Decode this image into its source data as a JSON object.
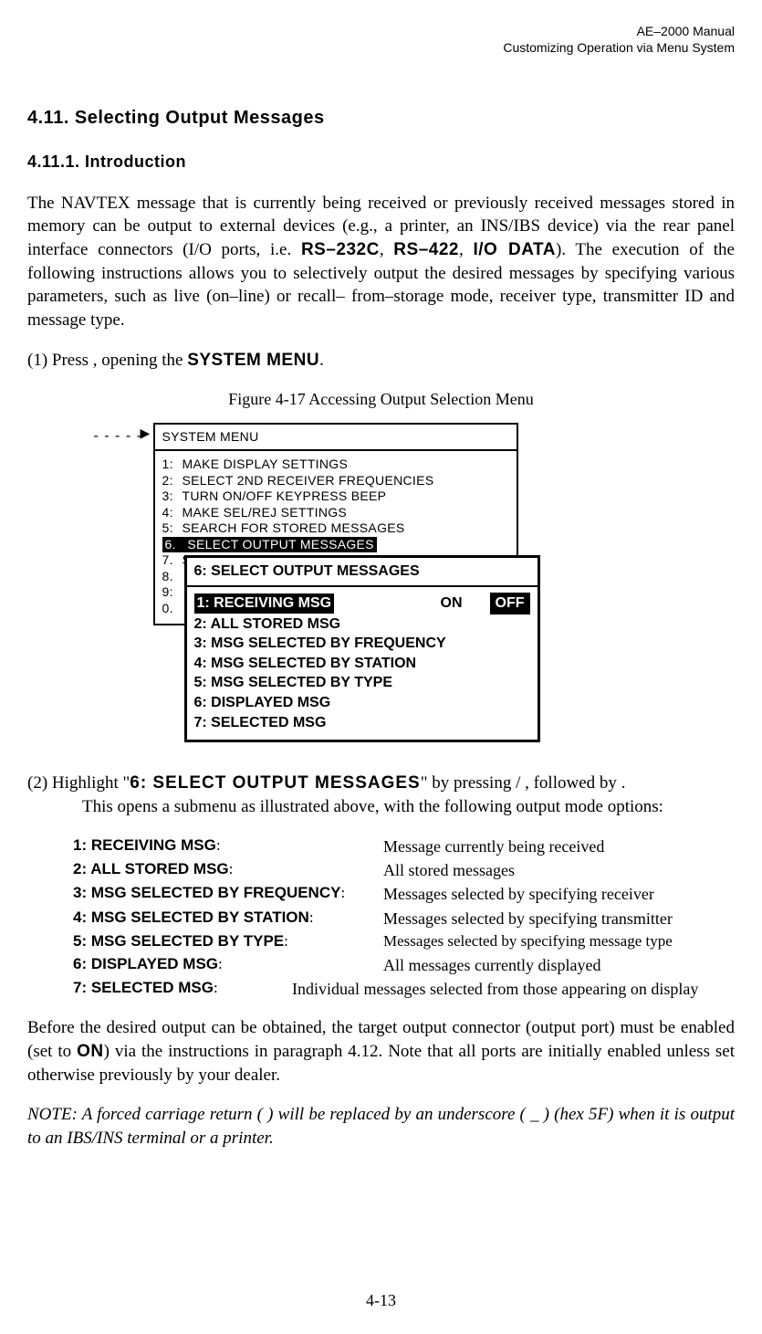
{
  "header": {
    "line1": "AE–2000 Manual",
    "line2": "Customizing Operation via Menu System"
  },
  "section_title": "4.11.  Selecting Output Messages",
  "subsection_title": "4.11.1.   Introduction",
  "intro_para": "The NAVTEX message that is currently being received or previously received messages stored in memory can be output to external devices (e.g., a printer, an INS/IBS device) via the rear panel interface connectors (I/O ports, i.e. ",
  "intro_rs232": "RS–232C",
  "intro_comma1": ", ",
  "intro_rs422": "RS–422",
  "intro_comma2": ", ",
  "intro_iodata": "I/O DATA",
  "intro_rest": "). The execution of the following instructions allows you to selectively output the desired messages by specifying various parameters, such as live (on–line) or recall– from–storage mode, receiver type, transmitter ID and message type.",
  "step1_pre": "(1)  Press       , opening the ",
  "step1_menu": "SYSTEM MENU",
  "step1_post": ".",
  "figure_caption": "Figure 4-17   Accessing Output Selection Menu",
  "menu": {
    "title": "SYSTEM MENU",
    "items": [
      {
        "num": "1:",
        "text": "MAKE DISPLAY SETTINGS"
      },
      {
        "num": "2:",
        "text": "SELECT 2ND RECEIVER FREQUENCIES"
      },
      {
        "num": "3:",
        "text": "TURN ON/OFF KEYPRESS BEEP"
      },
      {
        "num": "4:",
        "text": "MAKE SEL/REJ SETTINGS"
      },
      {
        "num": "5:",
        "text": "SEARCH FOR STORED MESSAGES"
      },
      {
        "num": "6.",
        "text": "SELECT OUTPUT MESSAGES",
        "hl": true
      },
      {
        "num": "7.",
        "text": "SET OUTPUT PORTS"
      },
      {
        "num": "8.",
        "text": ""
      },
      {
        "num": "9:",
        "text": ""
      },
      {
        "num": "0.",
        "text": ""
      }
    ]
  },
  "submenu": {
    "title": "6: SELECT OUTPUT MESSAGES",
    "row1_label": "1: RECEIVING MSG",
    "row1_on": "ON",
    "row1_off": "OFF",
    "items": [
      "2: ALL STORED MSG",
      "3: MSG SELECTED BY FREQUENCY",
      "4: MSG SELECTED BY STATION",
      "5: MSG SELECTED BY TYPE",
      "6: DISPLAYED MSG",
      "7: SELECTED MSG"
    ]
  },
  "step2_pre": "(2) Highlight \"",
  "step2_hl": "6: SELECT OUTPUT MESSAGES",
  "step2_mid": "\" by pressing       /      , followed by       .",
  "step2_cont": "This opens a submenu as illustrated above, with the following output mode options:",
  "defs": [
    {
      "label": "1: RECEIVING MSG",
      "colon": ":",
      "val": "Message currently being received"
    },
    {
      "label": "2: ALL STORED MSG",
      "colon": ":",
      "val": "All stored messages"
    },
    {
      "label": "3: MSG SELECTED BY FREQUENCY",
      "colon": ":",
      "val": "Messages selected by specifying receiver"
    },
    {
      "label": "4: MSG SELECTED BY STATION",
      "colon": ":",
      "val": "Messages selected by specifying transmitter"
    },
    {
      "label": "5: MSG SELECTED BY TYPE",
      "colon": ":",
      "val": "Messages selected by specifying message type"
    },
    {
      "label": "6: DISPLAYED MSG",
      "colon": ":",
      "val": "All messages currently displayed"
    },
    {
      "label": "7: SELECTED MSG",
      "colon": ":",
      "val": "Individual messages selected from those appearing on display"
    }
  ],
  "before_para_pre": "Before the desired output can be obtained, the target output connector (output port) must be enabled (set to ",
  "before_on": "ON",
  "before_para_post": ") via the instructions in paragraph 4.12. Note that all ports are initially enabled unless set otherwise previously by your dealer.",
  "note": "NOTE: A forced carriage return (   ) will be replaced by an underscore ( _ ) (hex 5F) when it is output to an IBS/INS terminal or a printer.",
  "page_num": "4-13"
}
